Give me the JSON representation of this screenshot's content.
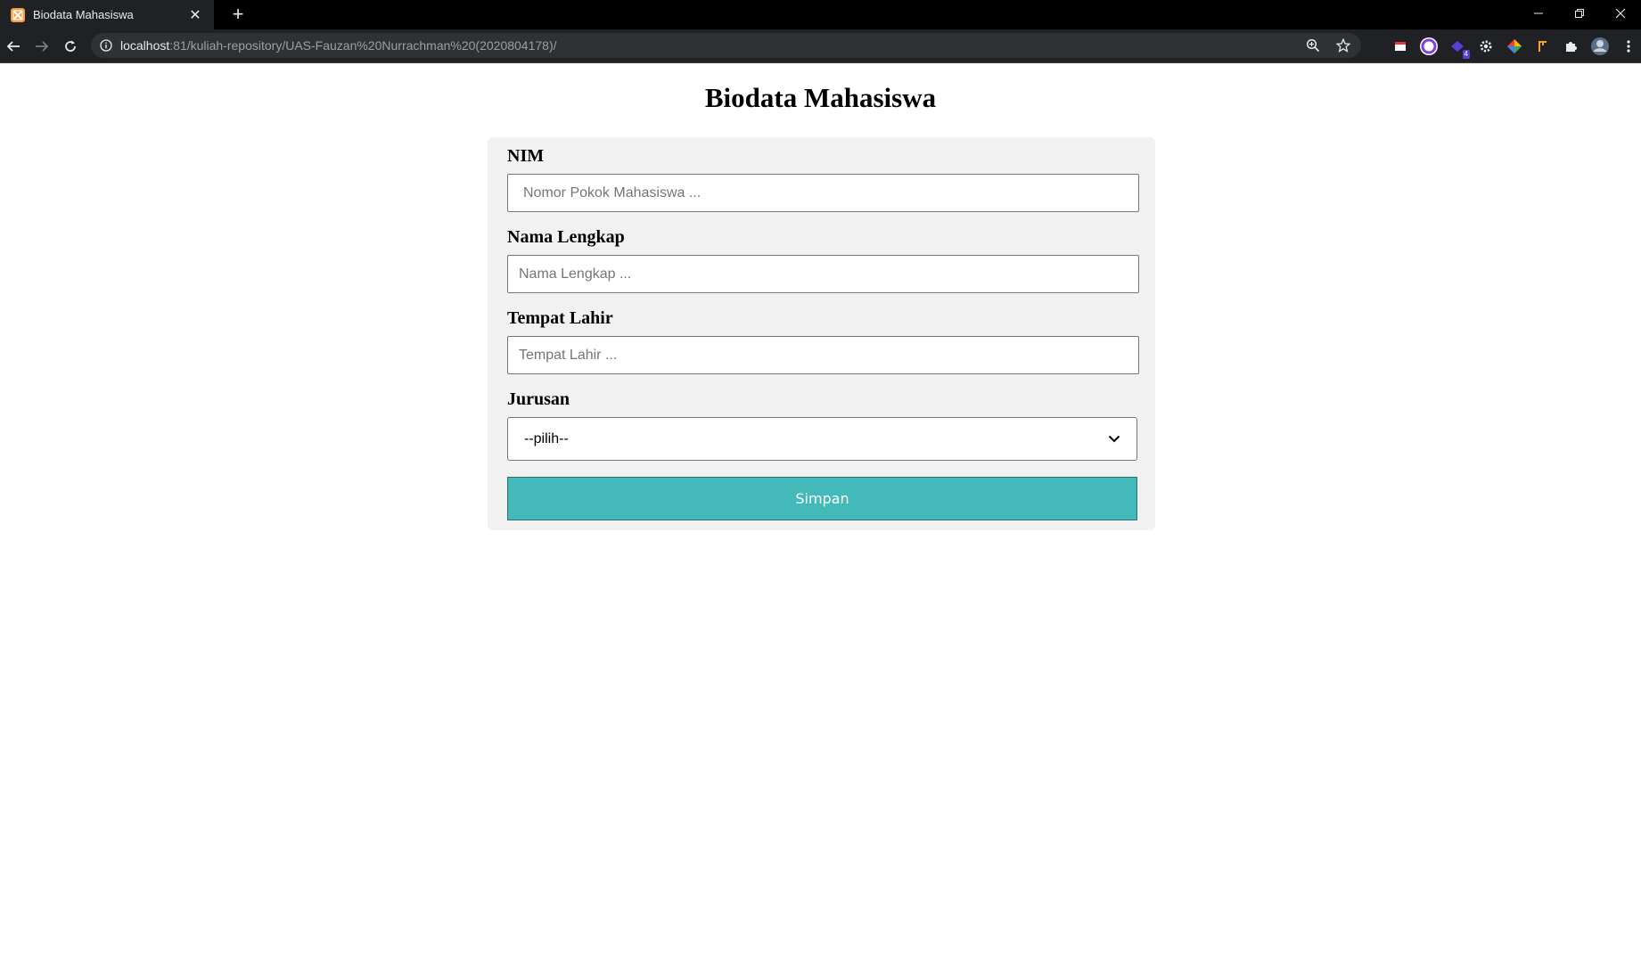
{
  "browser": {
    "tab_title": "Biodata Mahasiswa",
    "url_host": "localhost",
    "url_rest": ":81/kuliah-repository/UAS-Fauzan%20Nurrachman%20(2020804178)/",
    "extension_badge": "4",
    "icons": [
      "xampp-favicon",
      "back-arrow-icon",
      "forward-arrow-icon",
      "reload-icon",
      "info-icon",
      "zoom-icon",
      "star-icon",
      "puzzle-icon",
      "kebab-menu-icon"
    ]
  },
  "page": {
    "title": "Biodata Mahasiswa"
  },
  "form": {
    "nim_label": "NIM",
    "nim_placeholder": "Nomor Pokok Mahasiswa ...",
    "nama_label": "Nama Lengkap",
    "nama_placeholder": "Nama Lengkap ...",
    "tempat_label": "Tempat Lahir",
    "tempat_placeholder": "Tempat Lahir ...",
    "jurusan_label": "Jurusan",
    "jurusan_selected": "--pilih--",
    "submit_label": "Simpan"
  },
  "colors": {
    "submit_background": "#43b9b9",
    "card_background": "#f1f1f1",
    "favicon": "#f59b3a"
  }
}
